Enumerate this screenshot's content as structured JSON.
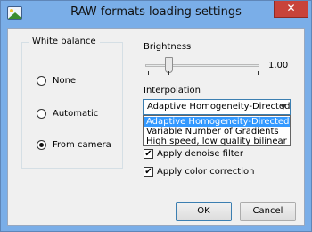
{
  "window": {
    "title": "RAW formats loading settings",
    "close_glyph": "✕"
  },
  "white_balance": {
    "legend": "White balance",
    "options": [
      {
        "label": "None",
        "checked": false
      },
      {
        "label": "Automatic",
        "checked": false
      },
      {
        "label": "From camera",
        "checked": true
      }
    ]
  },
  "brightness": {
    "label": "Brightness",
    "value": "1.00"
  },
  "interpolation": {
    "label": "Interpolation",
    "selected": "Adaptive Homogeneity-Directed",
    "options": [
      "Adaptive Homogeneity-Directed",
      "Variable Number of Gradients",
      "High speed, low quality bilinear"
    ]
  },
  "checkboxes": [
    {
      "label": "Apply denoise filter",
      "checked": true
    },
    {
      "label": "Apply color correction",
      "checked": true
    }
  ],
  "buttons": {
    "ok": "OK",
    "cancel": "Cancel"
  },
  "icons": {
    "app": "image-icon",
    "check": "✔"
  }
}
